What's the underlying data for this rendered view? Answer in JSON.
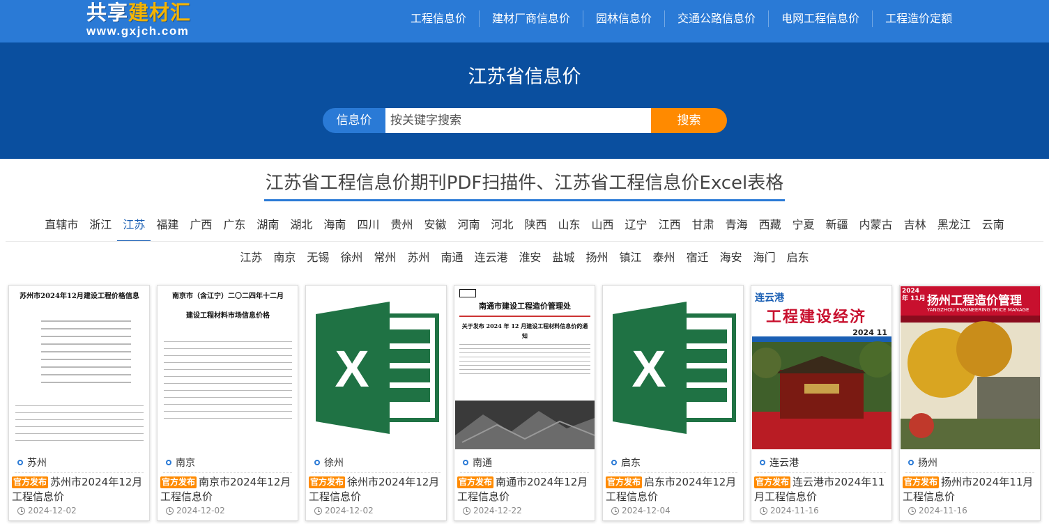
{
  "logo": {
    "name_part1": "共享",
    "name_part2": "建材汇",
    "domain": "www.gxjch.com"
  },
  "nav": [
    "工程信息价",
    "建材厂商信息价",
    "园林信息价",
    "交通公路信息价",
    "电网工程信息价",
    "工程造价定额"
  ],
  "hero": {
    "title": "江苏省信息价",
    "search_tag": "信息价",
    "search_placeholder": "按关键字搜索",
    "search_button": "搜索"
  },
  "section_title": "江苏省工程信息价期刊PDF扫描件、江苏省工程信息价Excel表格",
  "provinces": [
    "直辖市",
    "浙江",
    "江苏",
    "福建",
    "广西",
    "广东",
    "湖南",
    "湖北",
    "海南",
    "四川",
    "贵州",
    "安徽",
    "河南",
    "河北",
    "陕西",
    "山东",
    "山西",
    "辽宁",
    "江西",
    "甘肃",
    "青海",
    "西藏",
    "宁夏",
    "新疆",
    "内蒙古",
    "吉林",
    "黑龙江",
    "云南"
  ],
  "active_province": "江苏",
  "cities": [
    "江苏",
    "南京",
    "无锡",
    "徐州",
    "常州",
    "苏州",
    "南通",
    "连云港",
    "淮安",
    "盐城",
    "扬州",
    "镇江",
    "泰州",
    "宿迁",
    "海安",
    "海门",
    "启东"
  ],
  "badge_text": "官方发布",
  "cards": [
    {
      "city": "苏州",
      "title": "苏州市2024年12月工程信息价",
      "date": "2024-12-02",
      "thumb": "doc",
      "thumb_title": "苏州市2024年12月建设工程价格信息"
    },
    {
      "city": "南京",
      "title": "南京市2024年12月工程信息价",
      "date": "2024-12-02",
      "thumb": "doc",
      "thumb_title": "南京市（含江宁）二〇二四年十二月",
      "thumb_subtitle": "建设工程材料市场信息价格"
    },
    {
      "city": "徐州",
      "title": "徐州市2024年12月工程信息价",
      "date": "2024-12-02",
      "thumb": "excel"
    },
    {
      "city": "南通",
      "title": "南通市2024年12月工程信息价",
      "date": "2024-12-22",
      "thumb": "notice",
      "thumb_title": "南通市建设工程造价管理处",
      "thumb_subtitle": "关于发布 2024 年 12 月建设工程材料信息价的通知"
    },
    {
      "city": "启东",
      "title": "启东市2024年12月工程信息价",
      "date": "2024-12-04",
      "thumb": "excel"
    },
    {
      "city": "连云港",
      "title": "连云港市2024年11月工程信息价",
      "date": "2024-11-16",
      "thumb": "magazine-lyg",
      "thumb_title": "工程建设经济",
      "thumb_city": "连云港",
      "thumb_issue": "2024 11"
    },
    {
      "city": "扬州",
      "title": "扬州市2024年11月工程信息价",
      "date": "2024-11-16",
      "thumb": "magazine-yz",
      "thumb_title": "扬州工程造价管理",
      "thumb_subtitle": "YANGZHOU ENGINEERING PRICE MANAGE",
      "thumb_issue": "2024年 11月"
    }
  ],
  "colors": {
    "topbar": "#2a7ad6",
    "hero": "#0a4f9f",
    "accent_orange": "#ff8a00",
    "excel_green": "#1f7244"
  }
}
